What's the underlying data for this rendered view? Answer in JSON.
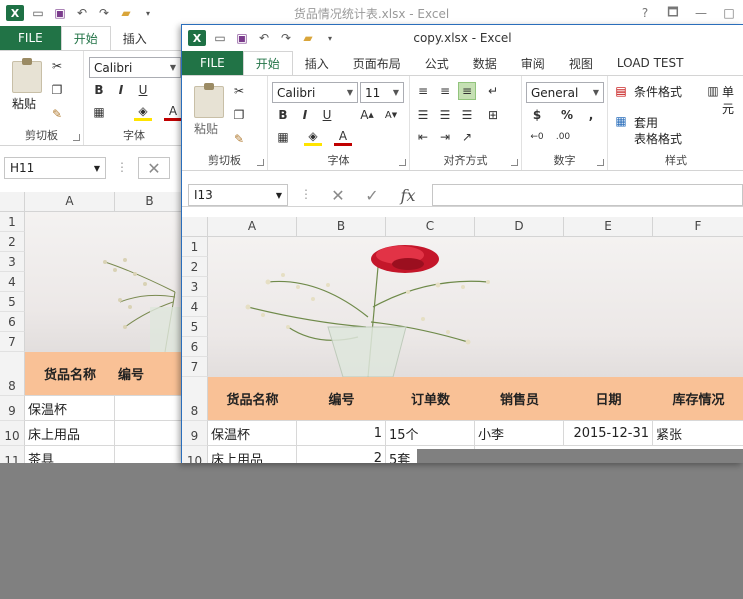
{
  "back_window": {
    "title": "货品情况统计表.xlsx - Excel",
    "window_buttons": [
      "?",
      "🗖",
      "—",
      "□"
    ],
    "tabs": [
      "FILE",
      "开始",
      "插入"
    ],
    "clipboard": {
      "paste": "粘贴",
      "label": "剪切板"
    },
    "font": {
      "name": "Calibri",
      "label": "字体"
    },
    "name_box": "H11",
    "columns": [
      "A",
      "B"
    ],
    "rows": [
      "1",
      "2",
      "3",
      "4",
      "5",
      "6",
      "7",
      "8",
      "9",
      "10",
      "11"
    ],
    "cells": {
      "a8": "货品名称",
      "b8": "编号",
      "a9": "保温杯",
      "a10": "床上用品",
      "a11": "茶具"
    }
  },
  "front_window": {
    "title": "copy.xlsx - Excel",
    "tabs": [
      "FILE",
      "开始",
      "插入",
      "页面布局",
      "公式",
      "数据",
      "审阅",
      "视图",
      "LOAD TEST"
    ],
    "clipboard": {
      "paste": "粘贴",
      "label": "剪切板"
    },
    "font": {
      "name": "Calibri",
      "size": "11",
      "label": "字体"
    },
    "alignment_label": "对齐方式",
    "number": {
      "format": "General",
      "label": "数字"
    },
    "styles": {
      "conditional": "条件格式",
      "table_format_1": "套用",
      "table_format_2": "表格格式",
      "cell": "单元",
      "label": "样式"
    },
    "name_box": "I13",
    "formula_fx": "fx",
    "columns": [
      "A",
      "B",
      "C",
      "D",
      "E",
      "F"
    ],
    "rows": [
      "1",
      "2",
      "3",
      "4",
      "5",
      "6",
      "7",
      "8",
      "9",
      "10"
    ],
    "header_row": [
      "货品名称",
      "编号",
      "订单数",
      "销售员",
      "日期",
      "库存情况"
    ],
    "data_rows": [
      [
        "保温杯",
        "1",
        "15个",
        "小李",
        "2015-12-31",
        "紧张"
      ],
      [
        "床上用品",
        "2",
        "5套",
        "",
        "",
        ""
      ]
    ]
  },
  "colors": {
    "excel_green": "#217346",
    "header_fill": "#f9c196",
    "background": "#808080"
  }
}
